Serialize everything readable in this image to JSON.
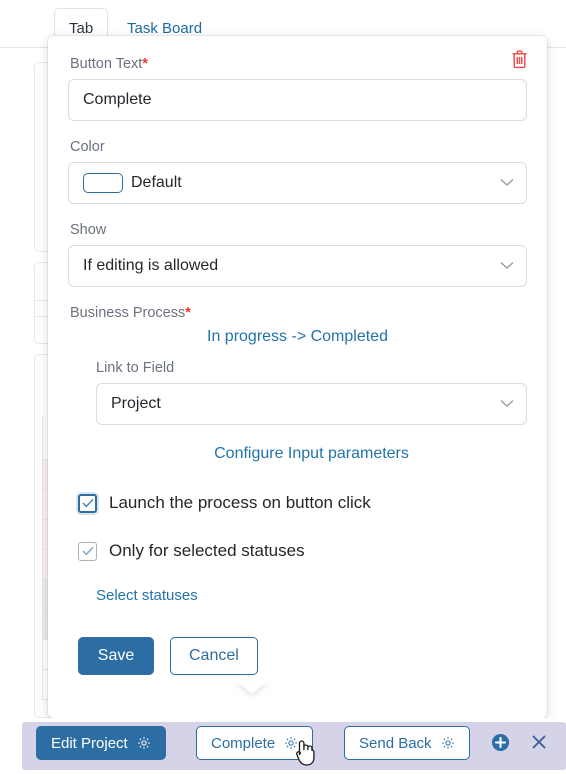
{
  "colors": {
    "accent_blue": "#2c6ea4",
    "link_blue": "#2374ab",
    "required_red": "#e8392e",
    "trash_red": "#ef4444",
    "actionbar_bg": "#d4d3e8",
    "label_grey": "#6b7280",
    "row_pink": "#fbeef0",
    "row_grey": "#eceded"
  },
  "tabs": {
    "active": "Tab",
    "link": "Task Board"
  },
  "popup": {
    "delete_icon": "trash-icon",
    "button_text": {
      "label": "Button Text",
      "required_marker": "*",
      "value": "Complete",
      "placeholder": "Button Text"
    },
    "color": {
      "label": "Color",
      "value": "Default",
      "swatch_hex": "#ffffff",
      "chevron_icon": "chevron-down-icon"
    },
    "show": {
      "label": "Show",
      "value": "If editing is allowed",
      "chevron_icon": "chevron-down-icon"
    },
    "business_process": {
      "label": "Business Process",
      "required_marker": "*",
      "value_link": "In progress -> Completed",
      "link_to_field": {
        "label": "Link to Field",
        "value": "Project",
        "chevron_icon": "chevron-down-icon"
      },
      "configure_link": "Configure Input parameters"
    },
    "checkboxes": [
      {
        "label": "Launch the process on button click",
        "checked": true,
        "focused": true
      },
      {
        "label": "Only for selected statuses",
        "checked": true,
        "focused": false
      }
    ],
    "select_statuses_link": "Select statuses",
    "buttons": {
      "save": "Save",
      "cancel": "Cancel"
    }
  },
  "actionbar": {
    "buttons": [
      {
        "label": "Edit Project",
        "style": "filled",
        "gear_icon": "gear-icon"
      },
      {
        "label": "Complete",
        "style": "outline",
        "gear_icon": "gear-icon"
      },
      {
        "label": "Send Back",
        "style": "outline",
        "gear_icon": "gear-icon"
      }
    ],
    "add_icon": "plus-circle-icon",
    "close_icon": "close-icon"
  }
}
